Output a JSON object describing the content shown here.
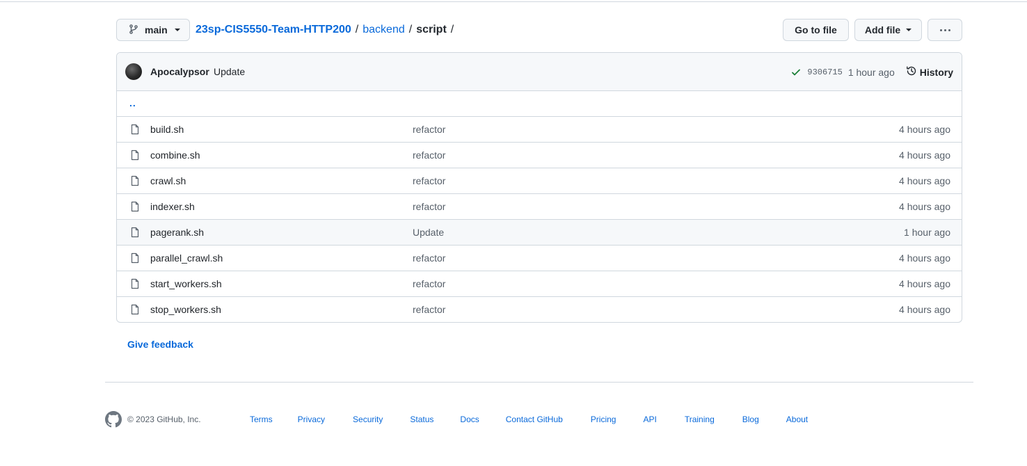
{
  "branch": {
    "name": "main"
  },
  "breadcrumb": {
    "repo": "23sp-CIS5550-Team-HTTP200",
    "dir": "backend",
    "current": "script",
    "sep": "/"
  },
  "toolbar": {
    "go_to_file": "Go to file",
    "add_file": "Add file"
  },
  "commit": {
    "author": "Apocalypsor",
    "message": "Update",
    "sha": "9306715",
    "time": "1 hour ago",
    "history_label": "History",
    "status_color": "#1a7f37"
  },
  "parent_dir": "..",
  "files": [
    {
      "name": "build.sh",
      "commit": "refactor",
      "age": "4 hours ago"
    },
    {
      "name": "combine.sh",
      "commit": "refactor",
      "age": "4 hours ago"
    },
    {
      "name": "crawl.sh",
      "commit": "refactor",
      "age": "4 hours ago"
    },
    {
      "name": "indexer.sh",
      "commit": "refactor",
      "age": "4 hours ago"
    },
    {
      "name": "pagerank.sh",
      "commit": "Update",
      "age": "1 hour ago"
    },
    {
      "name": "parallel_crawl.sh",
      "commit": "refactor",
      "age": "4 hours ago"
    },
    {
      "name": "start_workers.sh",
      "commit": "refactor",
      "age": "4 hours ago"
    },
    {
      "name": "stop_workers.sh",
      "commit": "refactor",
      "age": "4 hours ago"
    }
  ],
  "feedback": "Give feedback",
  "footer": {
    "copyright": "© 2023 GitHub, Inc.",
    "links": [
      "Terms",
      "Privacy",
      "Security",
      "Status",
      "Docs",
      "Contact GitHub",
      "Pricing",
      "API",
      "Training",
      "Blog",
      "About"
    ]
  },
  "colors": {
    "link": "#0969da",
    "border": "#d0d7de",
    "muted": "#57606a"
  }
}
